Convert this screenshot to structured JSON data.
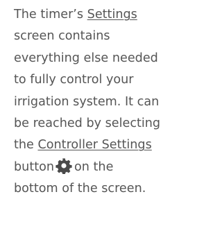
{
  "paragraph": {
    "line1_pre": "The timer’s ",
    "line1_link": "Settings",
    "line2": "screen contains",
    "line3": "everything else needed",
    "line4": "to fully control your",
    "line5": "irrigation system. It can",
    "line6": "be reached by selecting",
    "line7_pre": "the ",
    "line7_link": "Controller Settings",
    "line8_pre": "button",
    "line8_post": "on the",
    "line9": "bottom of the screen."
  },
  "icons": {
    "controller_settings": "gear-icon"
  },
  "colors": {
    "text": "#555555",
    "icon": "#4a4a4a"
  }
}
